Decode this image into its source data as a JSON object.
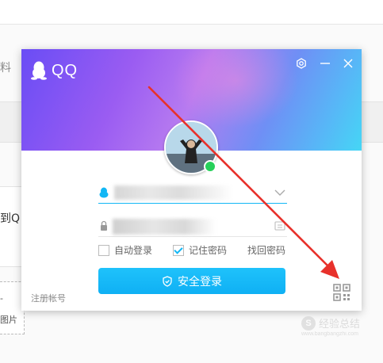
{
  "background": {
    "left_text_top": "料",
    "left_text_mid": "到Q",
    "left_box_dash": "-",
    "left_box_text": "图片"
  },
  "window": {
    "app_name": "QQ",
    "settings_icon": "settings-icon",
    "minimize_icon": "minimize-icon",
    "close_icon": "close-icon"
  },
  "account": {
    "value": "",
    "icon": "qq-penguin-icon",
    "dropdown_icon": "chevron-down-icon"
  },
  "password": {
    "value": "",
    "icon": "lock-icon",
    "keyboard_icon": "keyboard-icon"
  },
  "options": {
    "auto_login": {
      "label": "自动登录",
      "checked": false
    },
    "remember_password": {
      "label": "记住密码",
      "checked": true
    },
    "find_password": "找回密码"
  },
  "login_button": {
    "label": "安全登录",
    "icon": "shield-icon"
  },
  "register_link": "注册帐号",
  "qr_icon": "qr-code-icon",
  "status": {
    "online": true,
    "color": "#27d05a"
  },
  "colors": {
    "accent": "#12b7f5",
    "annotation": "#e8312b"
  },
  "watermark": {
    "logo": "S",
    "text": "经验总结",
    "sub": "www.bangbangzhi.com"
  }
}
